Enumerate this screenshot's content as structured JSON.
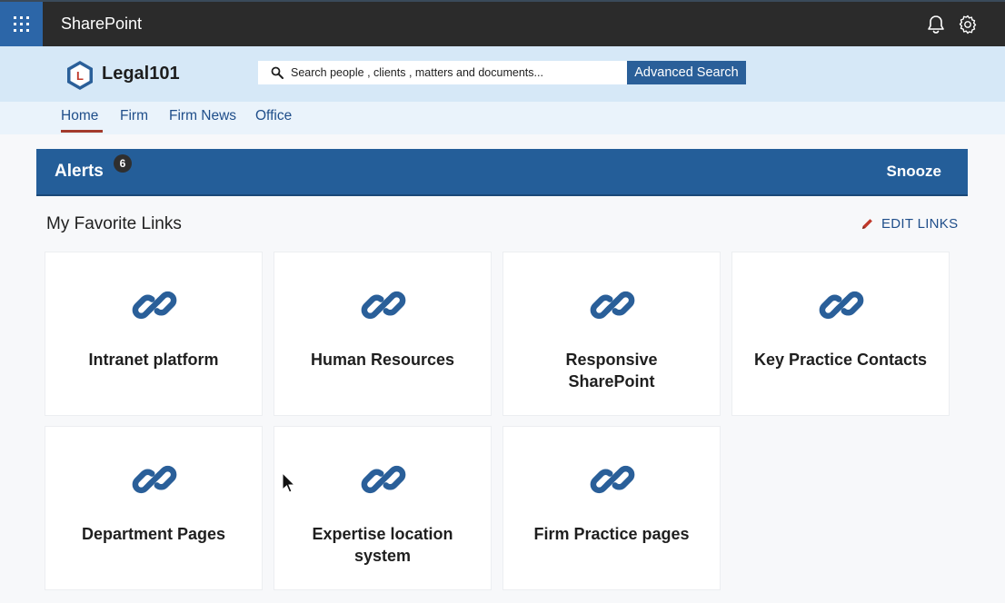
{
  "suite_bar": {
    "title": "SharePoint",
    "icons": [
      "waffle-icon",
      "bell-icon",
      "gear-icon"
    ]
  },
  "header": {
    "site_name": "Legal101",
    "logo_letter": "L",
    "search": {
      "placeholder": "Search people , clients , matters and documents..."
    },
    "advanced_search_label": "Advanced Search"
  },
  "nav": {
    "items": [
      {
        "label": "Home"
      },
      {
        "label": "Firm"
      },
      {
        "label": "Firm News"
      },
      {
        "label": "Office"
      }
    ],
    "active": "Home"
  },
  "alerts": {
    "title": "Alerts",
    "count": "6",
    "snooze_label": "Snooze"
  },
  "favorites": {
    "title": "My Favorite Links",
    "edit_label": "EDIT LINKS",
    "links": [
      {
        "label": "Intranet platform"
      },
      {
        "label": "Human Resources"
      },
      {
        "label": "Responsive SharePoint"
      },
      {
        "label": "Key Practice Contacts"
      },
      {
        "label": "Department Pages"
      },
      {
        "label": "Expertise location system"
      },
      {
        "label": "Firm Practice pages"
      }
    ]
  },
  "colors": {
    "suite_bar": "#2b2b2b",
    "waffle": "#2c66a8",
    "header_bg": "#d6e8f7",
    "accent": "#245e99",
    "link_icon": "#2a5f99",
    "active_underline": "#a33b2c"
  }
}
